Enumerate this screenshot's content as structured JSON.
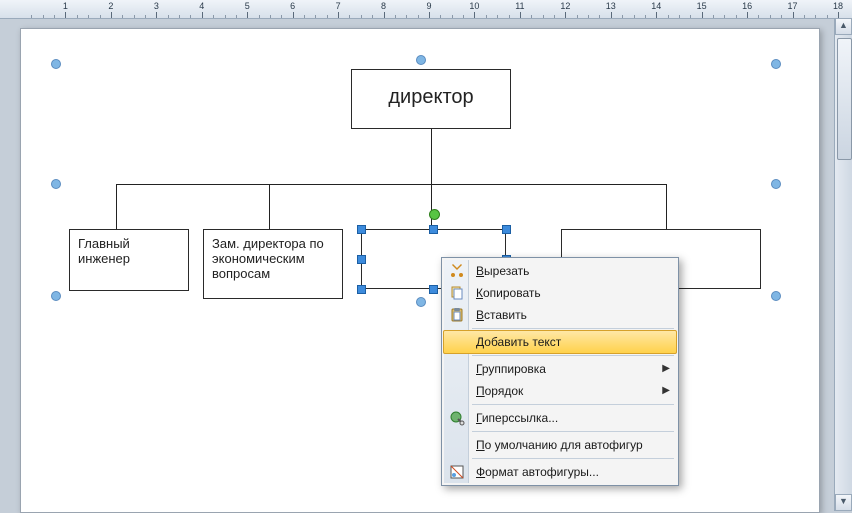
{
  "ruler": {
    "max_cm": 18
  },
  "org": {
    "root": {
      "label": "директор"
    },
    "child1": {
      "label": "Главный инженер"
    },
    "child2": {
      "label": "Зам. директора по экономическим вопросам"
    },
    "child3": {
      "label": ""
    },
    "child4": {
      "label": ""
    }
  },
  "context_menu": {
    "items": [
      {
        "key": "cut",
        "label": "Вырезать",
        "icon": "scissors-icon"
      },
      {
        "key": "copy",
        "label": "Копировать",
        "icon": "copy-icon"
      },
      {
        "key": "paste",
        "label": "Вставить",
        "icon": "paste-icon"
      },
      {
        "sep": true
      },
      {
        "key": "addtext",
        "label": "Добавить текст",
        "highlight": true
      },
      {
        "sep": true
      },
      {
        "key": "group",
        "label": "Группировка",
        "submenu": true
      },
      {
        "key": "order",
        "label": "Порядок",
        "submenu": true
      },
      {
        "sep": true
      },
      {
        "key": "hyperlink",
        "label": "Гиперссылка...",
        "icon": "globe-link-icon"
      },
      {
        "sep": true
      },
      {
        "key": "defaults",
        "label": "По умолчанию для автофигур"
      },
      {
        "sep": true
      },
      {
        "key": "format",
        "label": "Формат автофигуры...",
        "icon": "format-shape-icon"
      }
    ]
  }
}
